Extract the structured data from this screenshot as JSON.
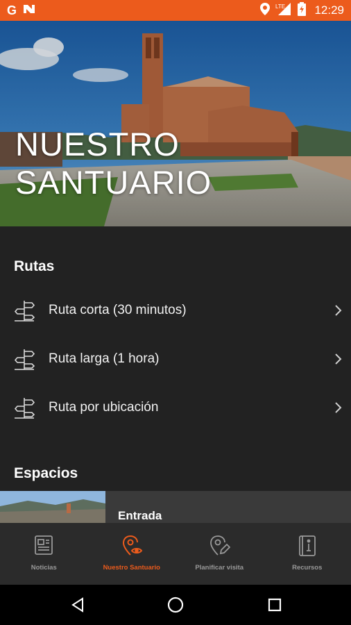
{
  "status_bar": {
    "time": "12:29",
    "network": "LTE",
    "left_icons": [
      "google-icon",
      "notification-app-icon"
    ],
    "right_icons": [
      "location-icon",
      "signal-icon",
      "battery-icon"
    ],
    "color": "#ec5b1c"
  },
  "hero": {
    "title": "NUESTRO\nSANTUARIO"
  },
  "routes": {
    "heading": "Rutas",
    "items": [
      {
        "label": "Ruta corta (30 minutos)",
        "icon": "signpost-icon"
      },
      {
        "label": "Ruta larga (1 hora)",
        "icon": "signpost-icon"
      },
      {
        "label": "Ruta por ubicación",
        "icon": "signpost-icon"
      }
    ]
  },
  "spaces": {
    "heading": "Espacios",
    "items": [
      {
        "title": "Entrada"
      }
    ]
  },
  "bottom_nav": {
    "items": [
      {
        "label": "Noticias",
        "icon": "newspaper-icon",
        "active": false
      },
      {
        "label": "Nuestro Santuario",
        "icon": "location-eye-icon",
        "active": true
      },
      {
        "label": "Planificar visita",
        "icon": "location-edit-icon",
        "active": false
      },
      {
        "label": "Recursos",
        "icon": "info-book-icon",
        "active": false
      }
    ],
    "accent": "#ec5b1c"
  },
  "system_nav": {
    "buttons": [
      "back-icon",
      "home-icon",
      "recents-icon"
    ]
  }
}
